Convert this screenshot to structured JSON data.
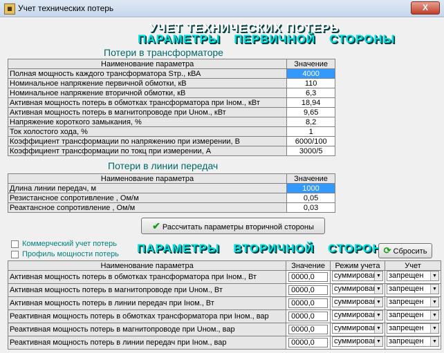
{
  "window": {
    "title": "Учет технических потерь",
    "close": "X"
  },
  "header": {
    "title": "УЧЕТ ТЕХНИЧЕСКИХ ПОТЕРЬ",
    "primary_subtitle": "ПАРАМЕТРЫ ПЕРВИЧНОЙ СТОРОНЫ",
    "secondary_subtitle": "ПАРАМЕТРЫ ВТОРИЧНОЙ СТОРОНЫ"
  },
  "transformer": {
    "title": "Потери в трансформаторе",
    "col_name": "Наименование параметра",
    "col_value": "Значение",
    "rows": [
      {
        "name": "Полная мощность каждого трансформатора Sтр., кВА",
        "value": "4000"
      },
      {
        "name": "Номинальное напряжение первичной обмотки, кВ",
        "value": "110"
      },
      {
        "name": "Номинальное напряжение вторичной обмотки, кВ",
        "value": "6,3"
      },
      {
        "name": "Активная мощность потерь в обмотках трансформатора при Iном., кВт",
        "value": "18,94"
      },
      {
        "name": "Активная мощность потерь в магнитопроводе при Uном., кВт",
        "value": "9,65"
      },
      {
        "name": "Напряжение короткого замыкания, %",
        "value": "8,2"
      },
      {
        "name": "Ток холостого хода, %",
        "value": "1"
      },
      {
        "name": "Коэффициент трансформации по напряжению при измерении, В",
        "value": "6000/100"
      },
      {
        "name": "Коэффициент трансформации по токц при измерении, А",
        "value": "3000/5"
      }
    ]
  },
  "line": {
    "title": "Потери в линии передач",
    "col_name": "Наименование параметра",
    "col_value": "Значение",
    "rows": [
      {
        "name": "Длина линии передач, м",
        "value": "1000"
      },
      {
        "name": "Резистансное сопротивление , Ом/м",
        "value": "0,05"
      },
      {
        "name": "Реактансное сопротивление , Ом/м",
        "value": "0,03"
      }
    ]
  },
  "calc_button": "Рассчитать параметры вторичной стороны",
  "checkboxes": {
    "commercial": "Коммерческий учет потерь",
    "profile": "Профиль мощности потерь"
  },
  "reset_button": "Сбросить",
  "secondary": {
    "col_name": "Наименование параметра",
    "col_value": "Значение",
    "col_mode": "Режим учета",
    "col_account": "Учет",
    "rows": [
      {
        "name": "Активная мощность потерь в обмотках трансформатора при Iном., Вт",
        "value": "0000,0",
        "mode": "суммирован",
        "account": "запрещен"
      },
      {
        "name": "Активная мощность потерь в магнитопроводе при Uном., Вт",
        "value": "0000,0",
        "mode": "суммирован",
        "account": "запрещен"
      },
      {
        "name": "Активная мощность потерь в линии передач при Iном., Вт",
        "value": "0000,0",
        "mode": "суммирован",
        "account": "запрещен"
      },
      {
        "name": "Реактивная мощность потерь в обмотках трансформатора при Iном., вар",
        "value": "0000,0",
        "mode": "суммирован",
        "account": "запрещен"
      },
      {
        "name": "Реактивная мощность потерь в магнитопроводе при Uном., вар",
        "value": "0000,0",
        "mode": "суммирован",
        "account": "запрещен"
      },
      {
        "name": "Реактивная мощность потерь в линии передач при Iном., вар",
        "value": "0000,0",
        "mode": "суммирован",
        "account": "запрещен"
      }
    ]
  }
}
